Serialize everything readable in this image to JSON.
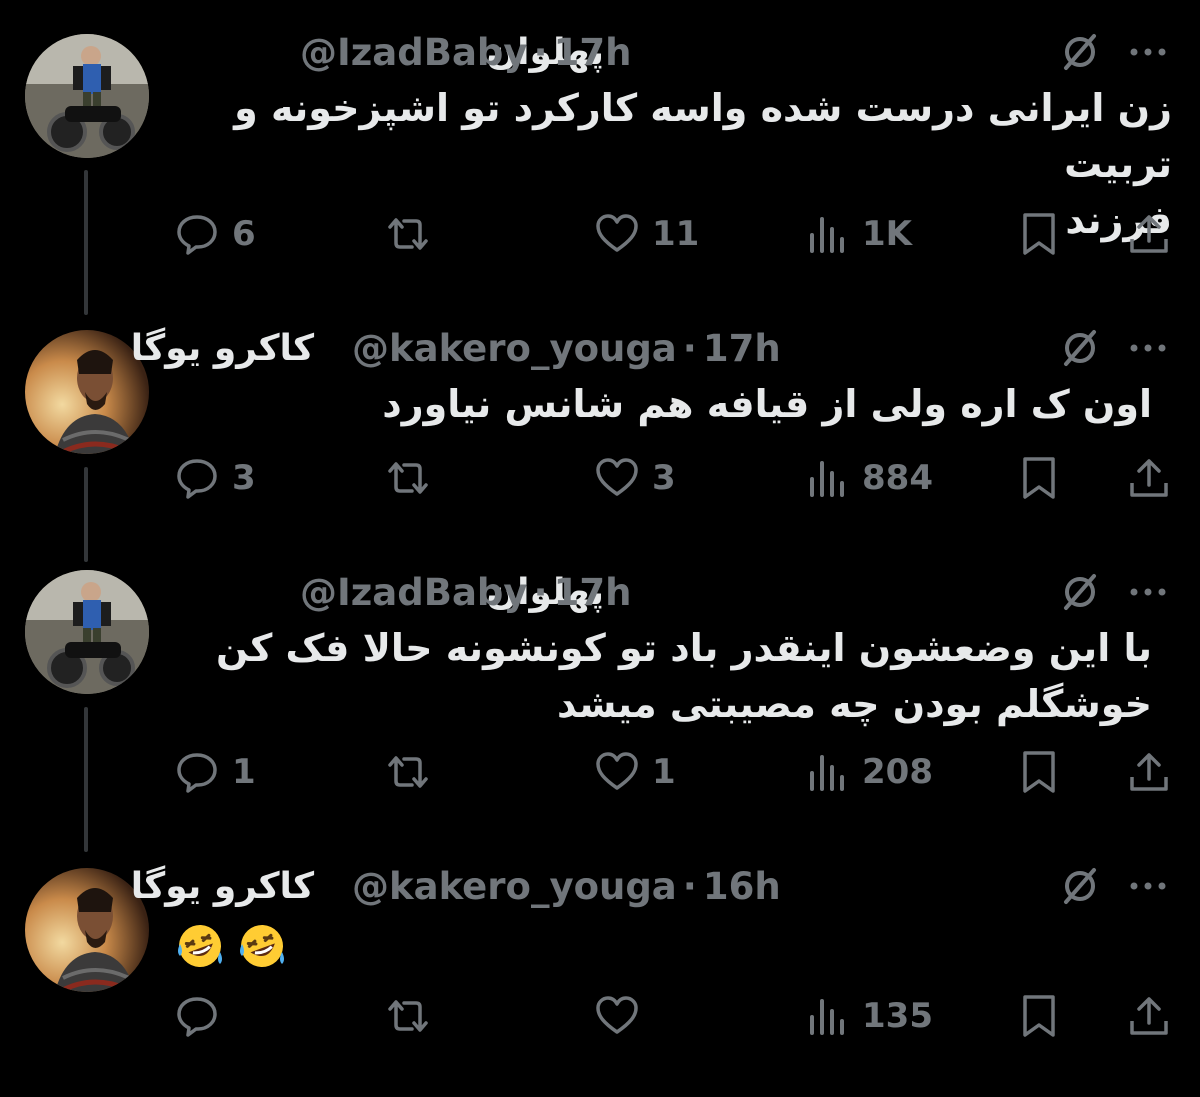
{
  "tweets": [
    {
      "name": "پهلوان",
      "handle": "@IzadBaby",
      "separator": "·",
      "time": "17h",
      "text": "زن ایرانی درست شده واسه کارکرد تو اشپزخونه و تربیت\nفرزند",
      "replies": "6",
      "retweets": "",
      "likes": "11",
      "views": "1K"
    },
    {
      "name": "کاکرو یوگا",
      "handle": "@kakero_youga",
      "separator": "·",
      "time": "17h",
      "text": "اون ک اره ولی از قیافه هم شانس نیاورد",
      "replies": "3",
      "retweets": "",
      "likes": "3",
      "views": "884"
    },
    {
      "name": "پهلوان",
      "handle": "@IzadBaby",
      "separator": "·",
      "time": "17h",
      "text": "با این وضعشون اینقدر باد تو کونشونه حالا فک کن\nخوشگلم بودن چه مصیبتی میشد",
      "replies": "1",
      "retweets": "",
      "likes": "1",
      "views": "208"
    },
    {
      "name": "کاکرو یوگا",
      "handle": "@kakero_youga",
      "separator": "·",
      "time": "16h",
      "text": "",
      "emojis": [
        "🤣",
        "🤣"
      ],
      "replies": "",
      "retweets": "",
      "likes": "",
      "views": "135"
    }
  ],
  "colors": {
    "background": "#000000",
    "text": "#e7e9ea",
    "muted": "#71767b",
    "thread_line": "#333639"
  },
  "icons": [
    "grok-icon",
    "more-icon",
    "reply-icon",
    "retweet-icon",
    "like-icon",
    "views-icon",
    "bookmark-icon",
    "share-icon"
  ]
}
